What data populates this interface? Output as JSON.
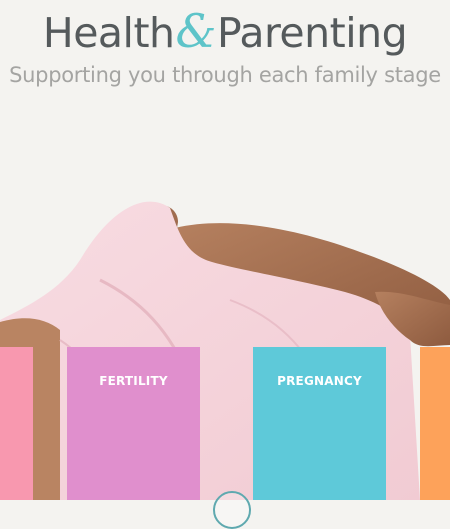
{
  "brand": {
    "logo_word_1": "Health",
    "logo_ampersand": "&",
    "logo_word_2": "Parenting",
    "tagline": "Supporting you through each family stage"
  },
  "colors": {
    "background": "#f4f3f0",
    "logo_text": "#555a5c",
    "logo_accent": "#5ec4c9",
    "tile_pink": "#f898af",
    "tile_fertility": "#e08fcd",
    "tile_pregnancy": "#5ec9d9",
    "tile_orange": "#fda25a"
  },
  "tiles": [
    {
      "label": ""
    },
    {
      "label": "FERTILITY"
    },
    {
      "label": "PREGNANCY"
    },
    {
      "label": ""
    }
  ],
  "hero_image": {
    "icon": "pregnant-woman-photo"
  },
  "scroll_indicator": {
    "icon": "scroll-down-circle-icon"
  }
}
